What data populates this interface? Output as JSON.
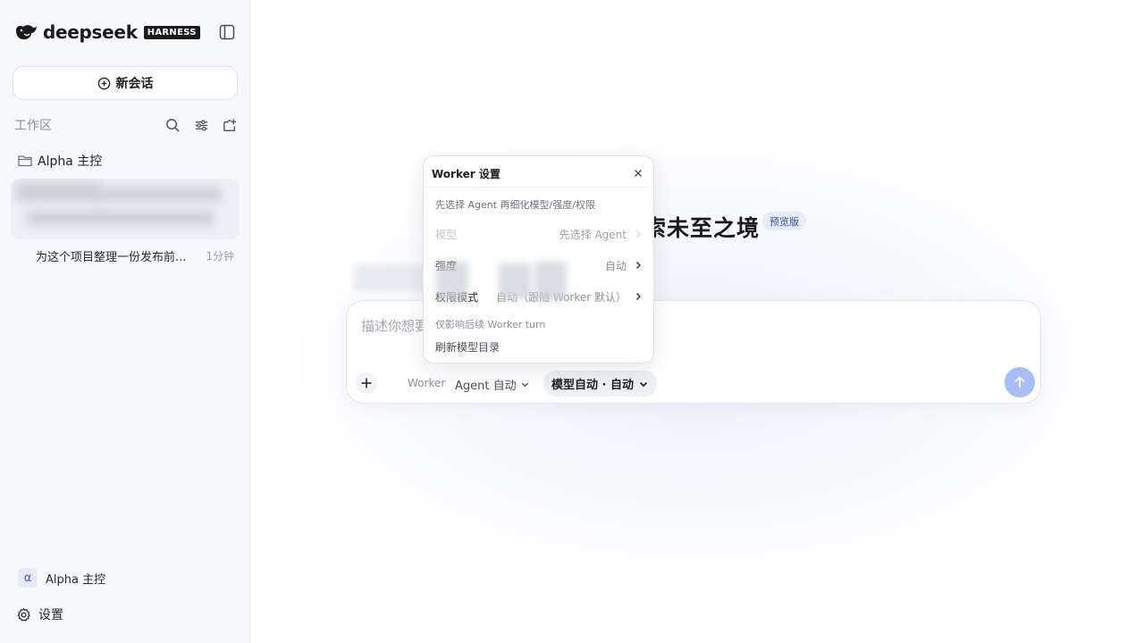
{
  "sidebar": {
    "brand": {
      "name": "deepseek",
      "badge": "HARNESS"
    },
    "new_chat_label": "新会话",
    "workspace_label": "工作区",
    "folder_name": "Alpha 主控",
    "chats": [
      {
        "title": "为这个项目整理一份发布前...",
        "time": "1分钟"
      }
    ],
    "profile": {
      "avatar_letter": "α",
      "name": "Alpha 主控"
    },
    "settings_label": "设置"
  },
  "main": {
    "hero_title_visible": "索未至之境",
    "preview_badge": "预览版",
    "composer": {
      "placeholder": "描述你想要",
      "worker_label": "Worker",
      "agent_select": "Agent 自动",
      "model_pill": "模型自动 · 自动"
    }
  },
  "popover": {
    "title": "Worker 设置",
    "hint": "先选择 Agent 再细化模型/强度/权限",
    "rows": [
      {
        "label": "模型",
        "value": "先选择 Agent",
        "disabled": true
      },
      {
        "label": "强度",
        "value": "自动",
        "disabled": false
      },
      {
        "label": "权限模式",
        "value": "自动（跟随 Worker 默认）",
        "disabled": false
      }
    ],
    "note": "仅影响后续 Worker turn",
    "refresh_label": "刷新模型目录"
  },
  "colors": {
    "accent": "#a8bdf4",
    "badge_bg": "#e7ecfb",
    "sidebar_bg": "#f6f8fc"
  },
  "icons": [
    "whale-logo-icon",
    "sidebar-toggle-icon",
    "plus-circle-icon",
    "search-icon",
    "filter-icon",
    "new-folder-icon",
    "folder-icon",
    "settings-gear-icon",
    "close-icon",
    "chevron-right-icon",
    "chevron-down-icon",
    "plus-icon",
    "arrow-up-icon"
  ]
}
